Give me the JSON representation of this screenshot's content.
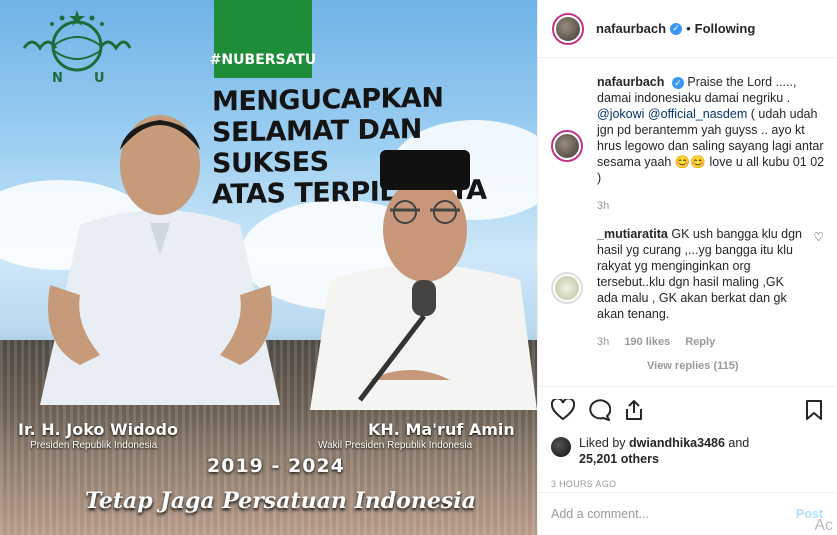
{
  "image": {
    "hashtag": "#NUBERSATU",
    "headline": [
      "MENGUCAPKAN",
      "SELAMAT DAN SUKSES",
      "ATAS TERPILIHNYA"
    ],
    "logo_letters": [
      "N",
      "U"
    ],
    "left_name": "Ir. H. Joko Widodo",
    "left_title": "Presiden Republik Indonesia",
    "right_name": "KH. Ma'ruf Amin",
    "right_title": "Wakil Presiden Republik Indonesia",
    "years": "2019 - 2024",
    "tagline": "Tetap Jaga Persatuan Indonesia"
  },
  "header": {
    "username": "nafaurbach",
    "separator": "•",
    "follow_status": "Following"
  },
  "caption": {
    "username": "nafaurbach",
    "text_1": "Praise the Lord .....,",
    "text_2": "damai indonesiaku damai negriku .",
    "mention_1": "@jokowi",
    "mention_2": "@official_nasdem",
    "text_3": "( udah udah jgn pd berantemm yah guyss .. ayo kt hrus legowo dan saling sayang lagi antar sesama yaah",
    "emoji": "😊😊",
    "text_4": "love u all kubu 01 02 )",
    "time": "3h"
  },
  "comment": {
    "username": "_mutiaratita",
    "text": "GK ush bangga klu dgn hasil yg curang ,...yg bangga itu klu rakyat yg menginginkan org tersebut..klu dgn hasil maling ,GK ada malu , GK akan berkat dan gk akan tenang.",
    "time": "3h",
    "likes": "190 likes",
    "reply_label": "Reply",
    "view_replies": "View replies (115)"
  },
  "likes": {
    "prefix": "Liked by",
    "user": "dwiandhika3486",
    "and": "and",
    "others": "25,201 others"
  },
  "timestamp": "3 HOURS AGO",
  "add_comment": {
    "placeholder": "Add a comment...",
    "post_label": "Post"
  },
  "corner_text": "Ac",
  "icons": [
    "heart-icon",
    "comment-icon",
    "share-icon",
    "bookmark-icon",
    "verified-icon"
  ],
  "colors": {
    "verified": "#3897f0",
    "link": "#003569",
    "banner_green": "#1f8c3a",
    "post_button": "#b2dffc"
  }
}
